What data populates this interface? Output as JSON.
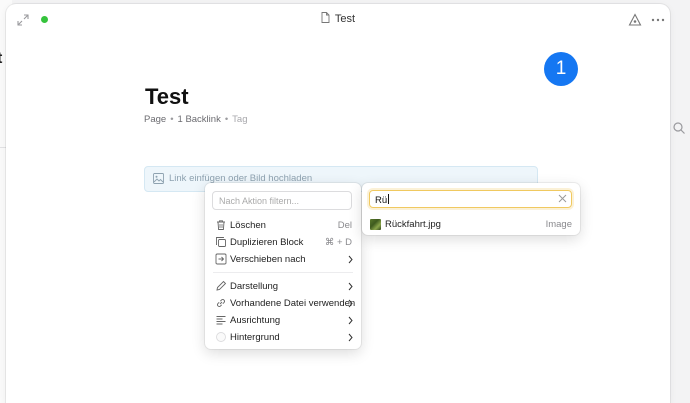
{
  "background": {
    "left_glyph": "t"
  },
  "window": {
    "title": "Test",
    "status_color": "#35c33c"
  },
  "badge": {
    "number": "1",
    "color": "#1577f2"
  },
  "page": {
    "title": "Test",
    "meta": {
      "type": "Page",
      "backlinks": "1 Backlink",
      "tag": "Tag"
    },
    "link_block": {
      "text": "Link einfügen oder Bild hochladen",
      "icon": "image-icon"
    }
  },
  "block_menu": {
    "filter_placeholder": "Nach Aktion filtern...",
    "items": [
      {
        "label": "Löschen",
        "shortcut": "Del",
        "icon": "trash-icon"
      },
      {
        "label": "Duplizieren Block",
        "shortcut": "⌘ + D",
        "icon": "duplicate-icon"
      },
      {
        "label": "Verschieben nach",
        "icon": "move-icon",
        "submenu": true
      },
      {
        "label": "Darstellung",
        "icon": "pencil-icon",
        "submenu": true
      },
      {
        "label": "Vorhandene Datei verwenden",
        "icon": "link-icon",
        "submenu": true
      },
      {
        "label": "Ausrichtung",
        "icon": "align-icon",
        "submenu": true
      },
      {
        "label": "Hintergrund",
        "icon": "color-circle-icon",
        "submenu": true
      }
    ]
  },
  "file_search": {
    "query": "Rü",
    "accent_color": "#f0c960",
    "results": [
      {
        "name": "Rückfahrt.jpg",
        "type": "Image"
      }
    ]
  }
}
